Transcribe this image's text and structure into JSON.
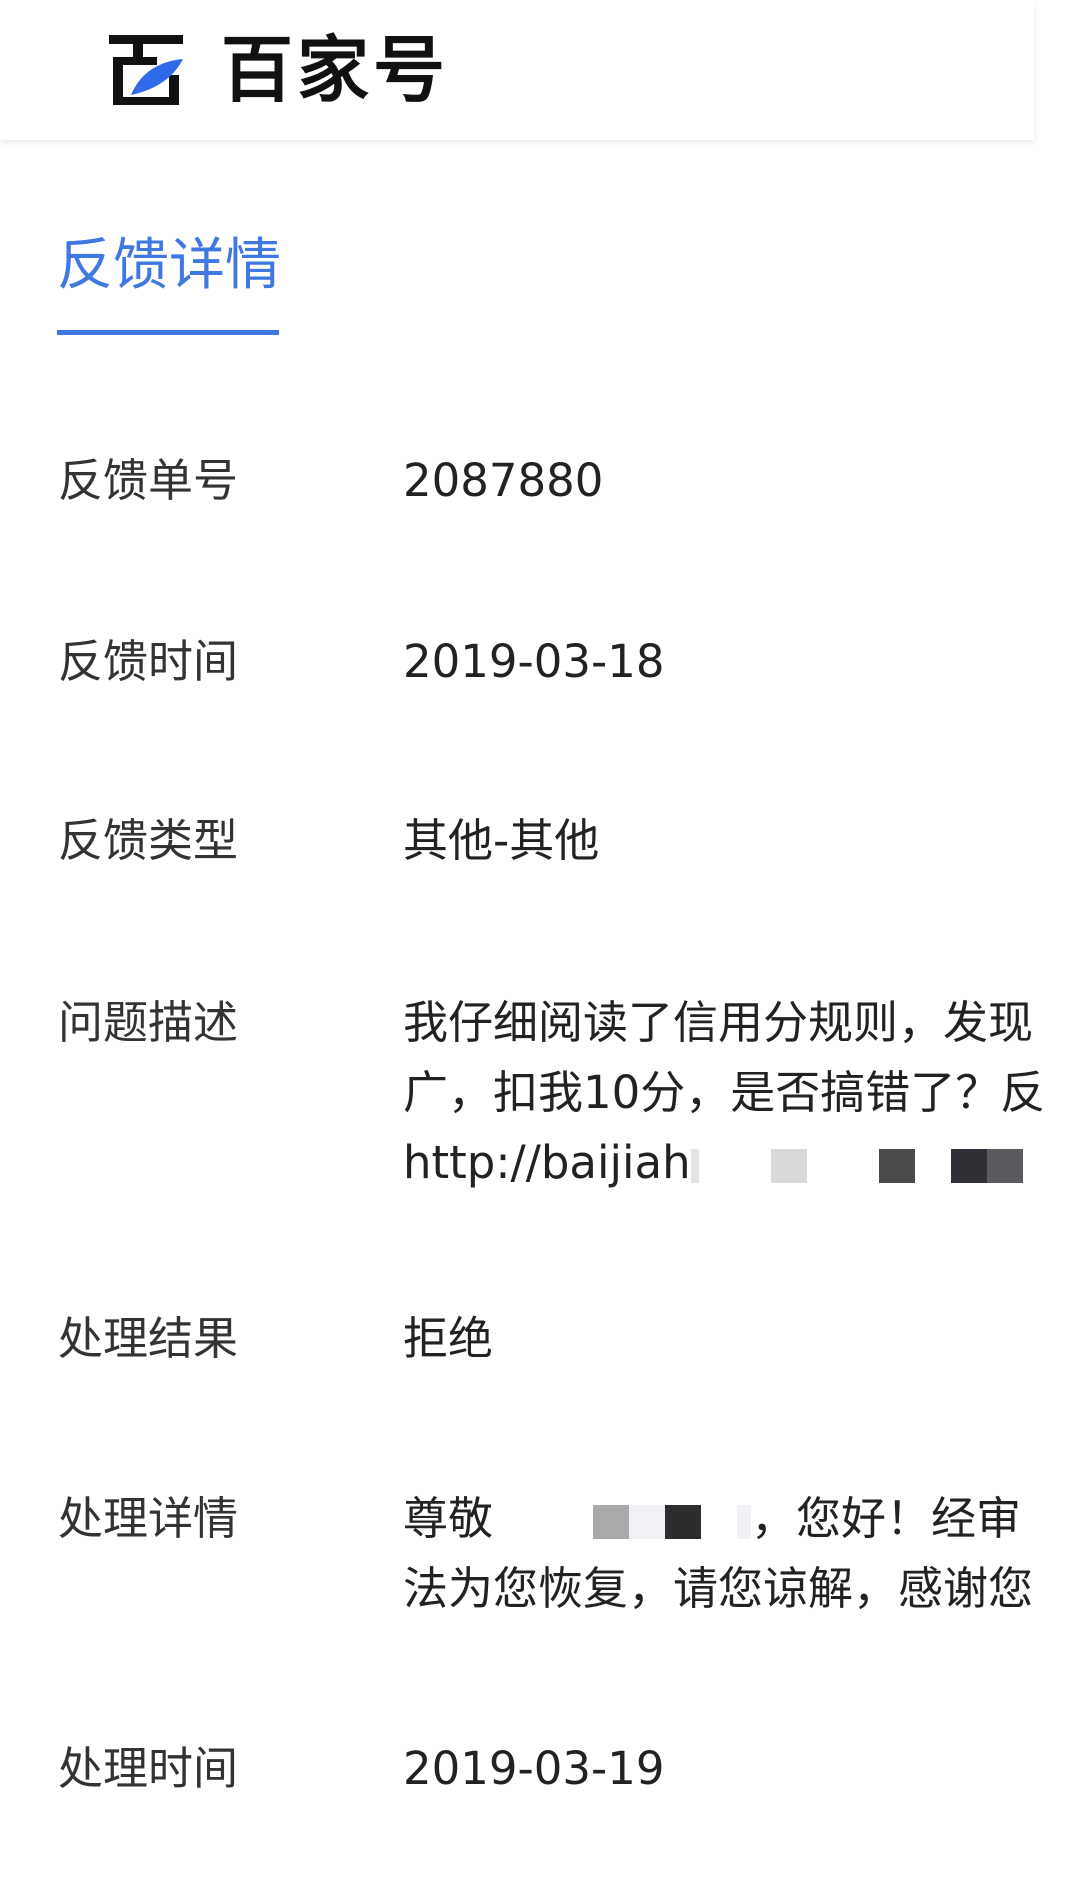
{
  "header": {
    "brand_name": "百家号",
    "logo_icon": "baijiahao-logo-icon",
    "accent_color": "#3f78e0"
  },
  "tab": {
    "label": "反馈详情"
  },
  "details": {
    "feedback_id": {
      "label": "反馈单号",
      "value": "2087880"
    },
    "feedback_time": {
      "label": "反馈时间",
      "value": "2019-03-18"
    },
    "feedback_type": {
      "label": "反馈类型",
      "value": "其他-其他"
    },
    "description": {
      "label": "问题描述",
      "line1": "我仔细阅读了信用分规则，发现",
      "line2": "广，扣我10分，是否搞错了？反",
      "line3_start": "http://baijiah",
      "line3_end": "c"
    },
    "result": {
      "label": "处理结果",
      "value": "拒绝"
    },
    "result_detail": {
      "label": "处理详情",
      "line1_start": "尊敬",
      "line1_end": "，您好！经审",
      "line2": "法为您恢复，请您谅解，感谢您"
    },
    "handle_time": {
      "label": "处理时间",
      "value": "2019-03-19"
    }
  }
}
